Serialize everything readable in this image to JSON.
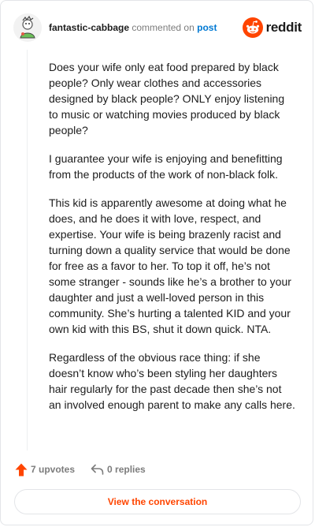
{
  "header": {
    "username": "fantastic-cabbage",
    "action_text": "commented on",
    "post_link": "post",
    "brand": "reddit"
  },
  "comment": {
    "paragraphs": [
      "Does your wife only eat food prepared by black people? Only wear clothes and accessories designed by black people? ONLY enjoy listening to music or watching movies produced by black people?",
      "I guarantee your wife is enjoying and benefitting from the products of the work of non-black folk.",
      "This kid is apparently awesome at doing what he does, and he does it with love, respect, and expertise. Your wife is being brazenly racist and turning down a quality service that would be done for free as a favor to her. To top it off, he’s not some stranger - sounds like he’s a brother to your daughter and just a well-loved person in this community. She’s hurting a talented KID and your own kid with this BS, shut it down quick. NTA.",
      "Regardless of the obvious race thing: if she doesn’t know who’s been styling her daughters hair regularly for the past decade then she’s not an involved enough parent to make any calls here."
    ]
  },
  "actions": {
    "upvotes": "7 upvotes",
    "replies": "0 replies"
  },
  "view_button": "View the conversation",
  "colors": {
    "brand_orange": "#ff4500",
    "link_blue": "#0079d3",
    "muted": "#7c7c7c"
  },
  "icons": {
    "avatar": "user-avatar",
    "brand": "reddit-snoo-icon",
    "upvote": "upvote-arrow-icon",
    "reply": "reply-arrow-icon"
  }
}
